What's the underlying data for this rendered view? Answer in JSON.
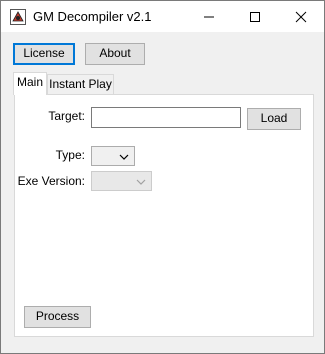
{
  "window": {
    "title": "GM Decompiler v2.1",
    "icons": {
      "app": "gamemaker-app-icon",
      "minimize": "minimize-icon",
      "maximize": "maximize-icon",
      "close": "close-icon"
    }
  },
  "toolbar": {
    "license_label": "License",
    "about_label": "About"
  },
  "tabs": [
    {
      "label": "Main",
      "active": true
    },
    {
      "label": "Instant Play",
      "active": false
    }
  ],
  "main": {
    "target_label": "Target:",
    "target_value": "",
    "load_label": "Load",
    "type_label": "Type:",
    "type_value": "",
    "exe_version_label": "Exe Version:",
    "exe_version_value": "",
    "process_label": "Process"
  }
}
